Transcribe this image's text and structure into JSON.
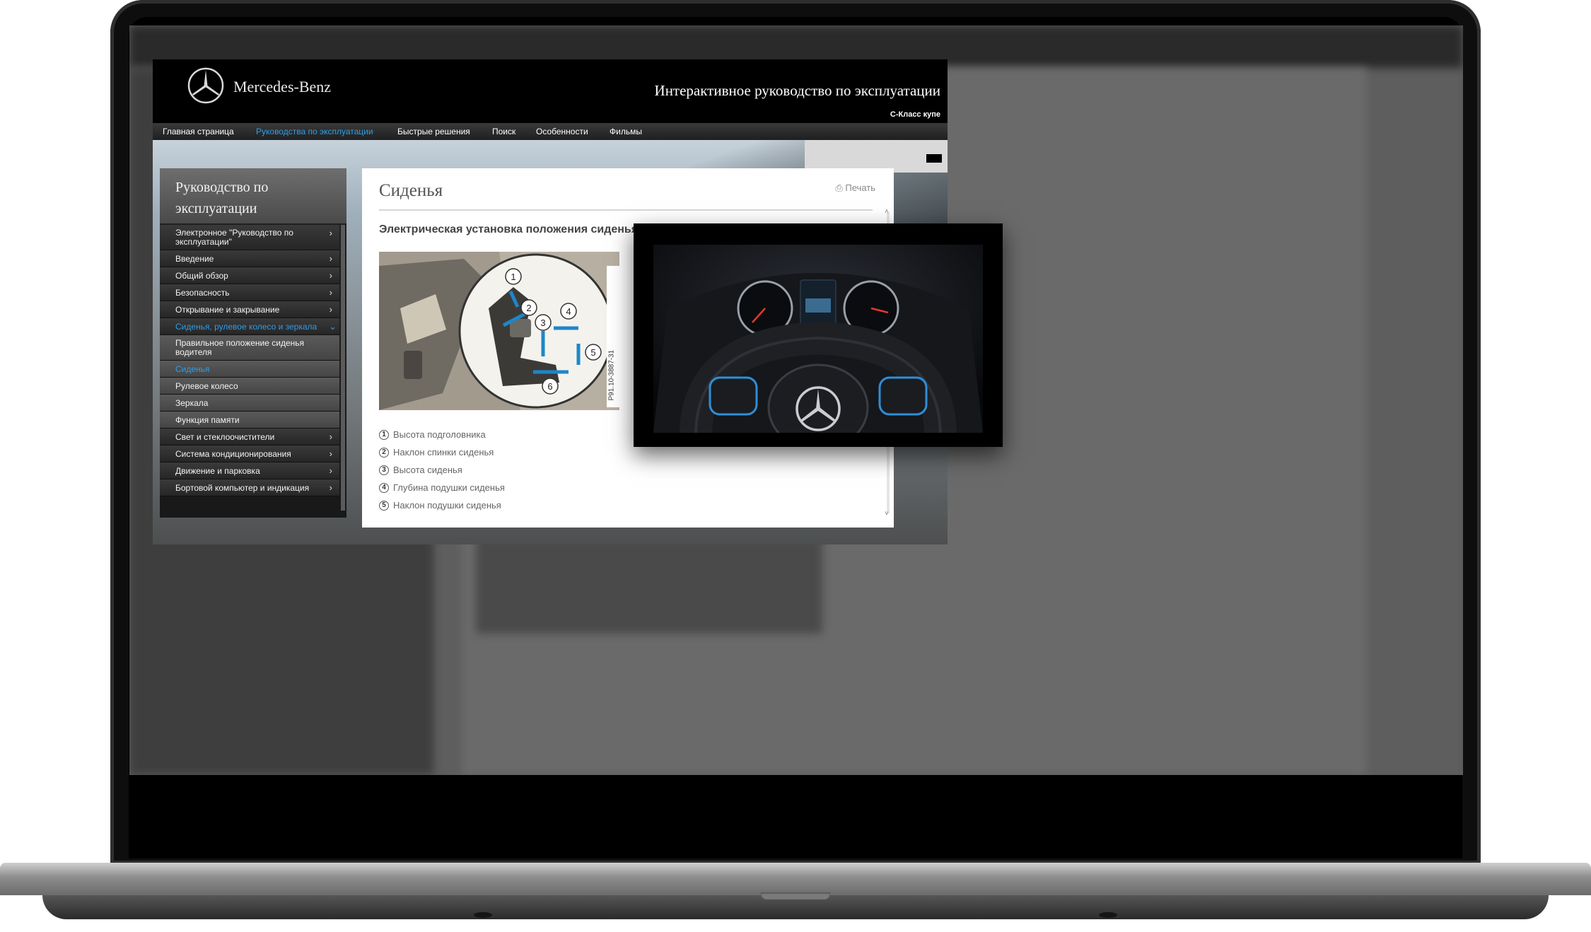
{
  "header": {
    "brand": "Mercedes-Benz",
    "title": "Интерактивное руководство по эксплуатации",
    "model": "C-Класс купе"
  },
  "nav": [
    {
      "label": "Главная страница",
      "active": false
    },
    {
      "label": "Руководства по эксплуатации",
      "active": true
    },
    {
      "label": "Быстрые решения",
      "active": false
    },
    {
      "label": "Поиск",
      "active": false
    },
    {
      "label": "Особенности",
      "active": false
    },
    {
      "label": "Фильмы",
      "active": false
    }
  ],
  "sidebar": {
    "title": "Руководство по эксплуатации",
    "items": [
      {
        "label": "Электронное \"Руководство по эксплуатации\"",
        "chevron": "›"
      },
      {
        "label": "Введение",
        "chevron": "›"
      },
      {
        "label": "Общий обзор",
        "chevron": "›"
      },
      {
        "label": "Безопасность",
        "chevron": "›"
      },
      {
        "label": "Открывание и закрывание",
        "chevron": "›"
      },
      {
        "label": "Сиденья, рулевое колесо и зеркала",
        "chevron": "⌄"
      },
      {
        "label": "Правильное положение сиденья водителя",
        "chevron": ""
      },
      {
        "label": "Сиденья",
        "chevron": ""
      },
      {
        "label": "Рулевое колесо",
        "chevron": ""
      },
      {
        "label": "Зеркала",
        "chevron": ""
      },
      {
        "label": "Функция памяти",
        "chevron": ""
      },
      {
        "label": "Свет и стеклоочистители",
        "chevron": "›"
      },
      {
        "label": "Система кондиционирования",
        "chevron": "›"
      },
      {
        "label": "Движение и парковка",
        "chevron": "›"
      },
      {
        "label": "Бортовой компьютер и индикация",
        "chevron": "›"
      }
    ]
  },
  "content": {
    "title": "Сиденья",
    "print": "Печать",
    "subtitle": "Электрическая установка положения сиденья",
    "diagram_code": "P91.10-3887-31",
    "callouts": [
      "1",
      "2",
      "3",
      "4",
      "5",
      "6"
    ],
    "legend": [
      {
        "num": "1",
        "text": "Высота подголовника"
      },
      {
        "num": "2",
        "text": "Наклон спинки сиденья"
      },
      {
        "num": "3",
        "text": "Высота сиденья"
      },
      {
        "num": "4",
        "text": "Глубина подушки сиденья"
      },
      {
        "num": "5",
        "text": "Наклон подушки сиденья"
      }
    ]
  },
  "colors": {
    "accent_blue": "#2f9de8",
    "header_bg": "#000000",
    "content_bg": "#ffffff"
  }
}
